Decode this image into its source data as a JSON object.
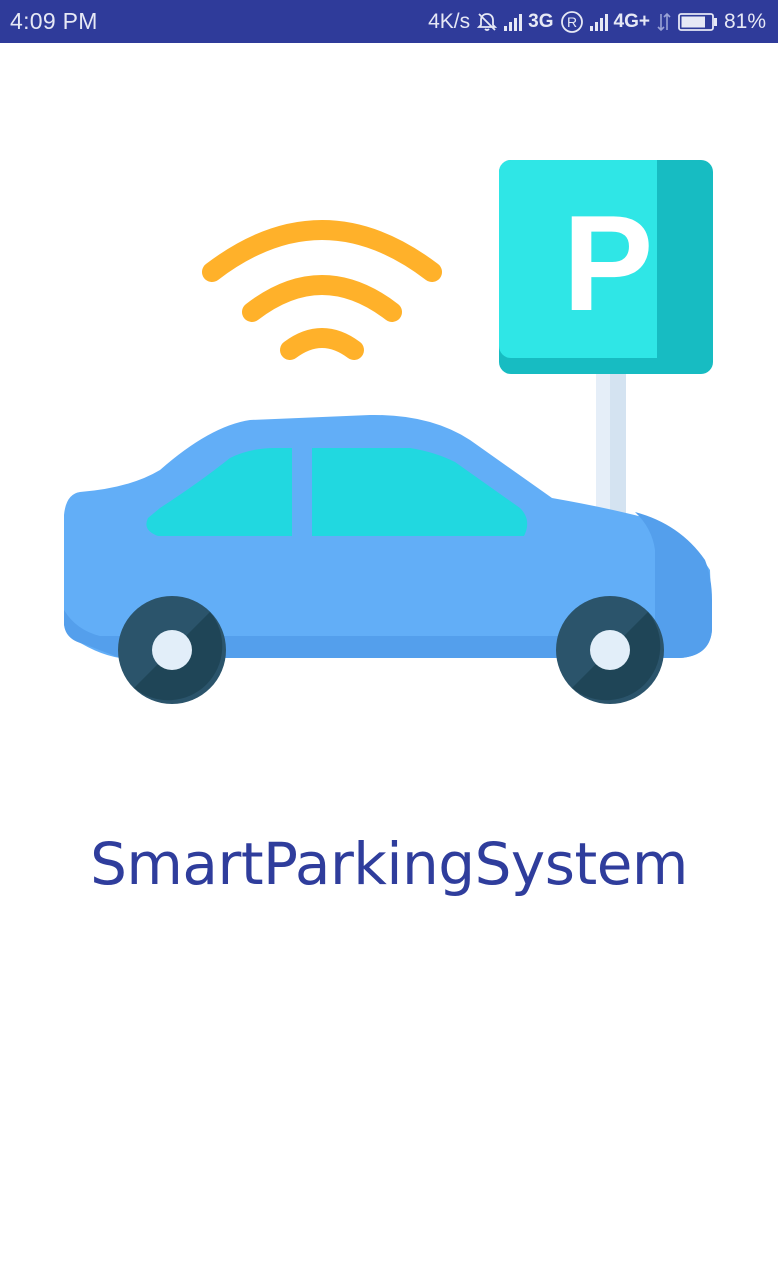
{
  "status_bar": {
    "time": "4:09 PM",
    "network_speed": "4K/s",
    "network_3g": "3G",
    "roaming": "R",
    "network_4g": "4G+",
    "battery_percent": "81%",
    "battery_level": 0.81,
    "icons": [
      "muted-bell-icon",
      "signal-icon",
      "roaming-icon",
      "signal-icon",
      "data-arrows-icon",
      "battery-icon"
    ]
  },
  "hero": {
    "icons": [
      "wifi-signal-icon",
      "parking-sign-icon",
      "car-icon"
    ],
    "parking_letter": "P",
    "colors": {
      "wifi": "#ffb12a",
      "sign": "#2fe6e6",
      "sign_shade": "#17bcc2",
      "car_body": "#62aef7",
      "windows": "#21d8e0",
      "wheels": "#2b546b"
    }
  },
  "app": {
    "title": "SmartParkingSystem",
    "title_color": "#2f3d9c"
  }
}
